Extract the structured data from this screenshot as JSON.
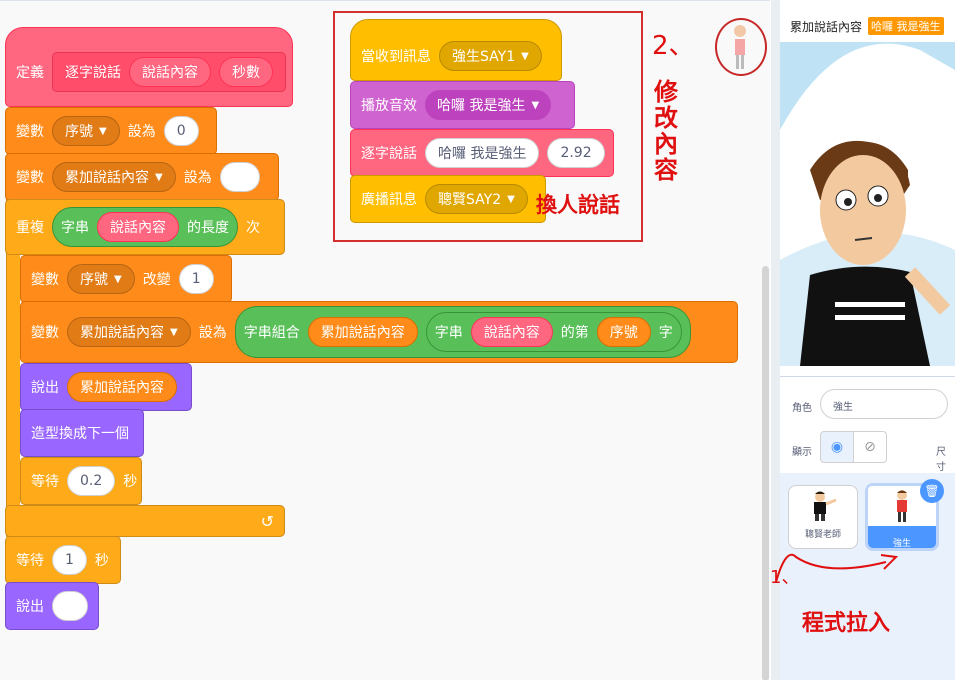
{
  "scripts": {
    "define": {
      "label": "定義",
      "name": "逐字說話",
      "arg1": "說話內容",
      "arg2": "秒數"
    },
    "set_index": {
      "label": "變數",
      "var": "序號",
      "set": "設為",
      "value": "0"
    },
    "set_accum": {
      "label": "變數",
      "var": "累加說話內容",
      "set": "設為",
      "value": ""
    },
    "repeat": {
      "label": "重複",
      "str": "字串",
      "arg": "說話內容",
      "len": "的長度",
      "times": "次"
    },
    "change_index": {
      "label": "變數",
      "var": "序號",
      "change": "改變",
      "value": "1"
    },
    "set_accum2": {
      "label": "變數",
      "var": "累加說話內容",
      "set": "設為",
      "join": "字串組合",
      "a": "累加說話內容",
      "str": "字串",
      "arg": "說話內容",
      "nth": "的第",
      "idx": "序號",
      "char": "字"
    },
    "say_accum": {
      "label": "說出",
      "value": "累加說話內容"
    },
    "next_costume": {
      "label": "造型換成下一個"
    },
    "wait_inner": {
      "label": "等待",
      "value": "0.2",
      "unit": "秒"
    },
    "wait_outer": {
      "label": "等待",
      "value": "1",
      "unit": "秒"
    },
    "say_empty": {
      "label": "說出",
      "value": ""
    }
  },
  "script2": {
    "when_receive": {
      "label": "當收到訊息",
      "msg": "強生SAY1"
    },
    "play_sound": {
      "label": "播放音效",
      "sound": "哈囉 我是強生"
    },
    "say_word": {
      "label": "逐字說話",
      "text": "哈囉 我是強生",
      "secs": "2.92"
    },
    "broadcast": {
      "label": "廣播訊息",
      "msg": "聰賢SAY2"
    }
  },
  "annotations": {
    "two": "2、",
    "modify": "修改內容",
    "swap": "換人說話",
    "one": "1、",
    "drag": "程式拉入",
    "color": "#e01010"
  },
  "stage": {
    "title": "累加說話內容",
    "badge": "哈囉 我是強生"
  },
  "sprite_info": {
    "sprite_label": "角色",
    "sprite_name": "強生",
    "show_label": "顯示",
    "size_label": "尺寸"
  },
  "sprites": [
    {
      "name": "聰賢老師",
      "selected": false
    },
    {
      "name": "強生",
      "selected": true
    }
  ]
}
